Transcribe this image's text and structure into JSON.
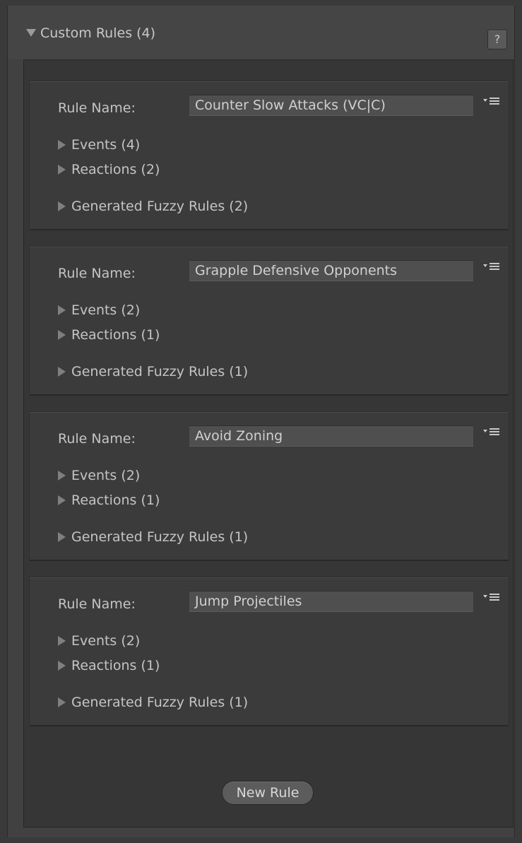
{
  "header": {
    "title": "Custom Rules (4)",
    "help_label": "?"
  },
  "rule_name_label": "Rule Name:",
  "rules": [
    {
      "name": "Counter Slow Attacks (VC|C)",
      "events": "Events (4)",
      "reactions": "Reactions (2)",
      "generated": "Generated Fuzzy Rules (2)"
    },
    {
      "name": "Grapple Defensive Opponents",
      "events": "Events (2)",
      "reactions": "Reactions (1)",
      "generated": "Generated Fuzzy Rules (1)"
    },
    {
      "name": "Avoid Zoning",
      "events": "Events (2)",
      "reactions": "Reactions (1)",
      "generated": "Generated Fuzzy Rules (1)"
    },
    {
      "name": "Jump Projectiles",
      "events": "Events (2)",
      "reactions": "Reactions (1)",
      "generated": "Generated Fuzzy Rules (1)"
    }
  ],
  "new_rule_label": "New Rule",
  "icons": {
    "fold_open": "triangle-down-icon",
    "fold_closed": "triangle-right-icon",
    "menu": "dropdown-menu-icon",
    "help": "help-icon"
  }
}
